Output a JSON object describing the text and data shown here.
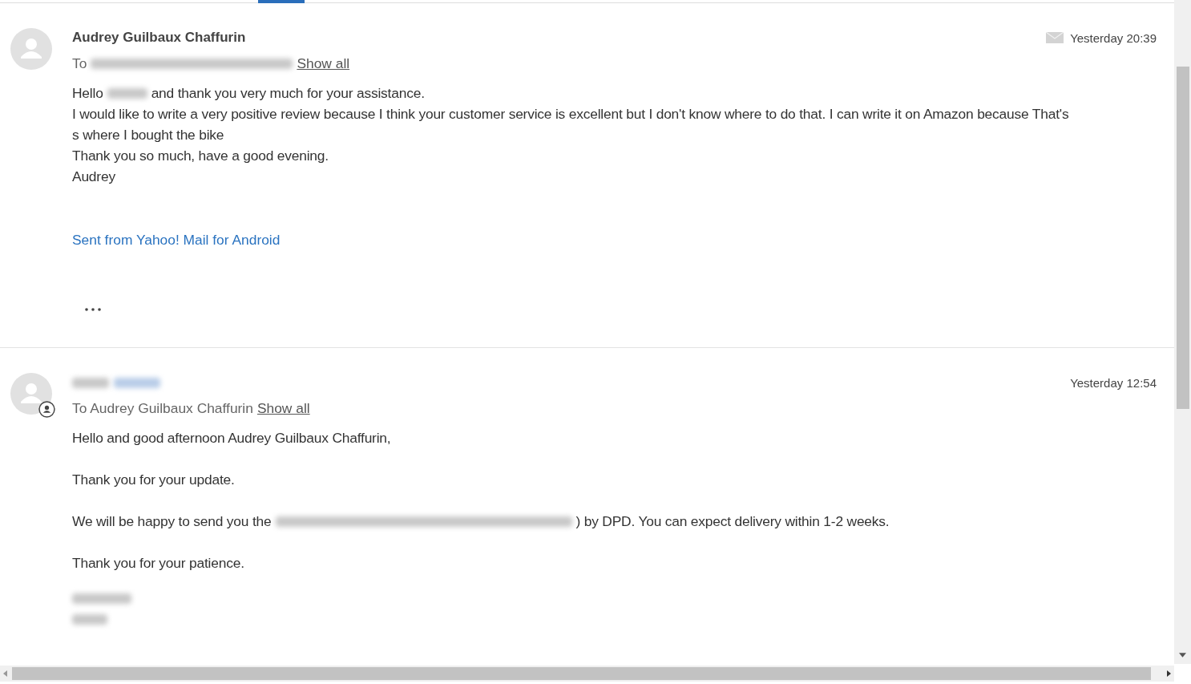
{
  "messages": [
    {
      "sender": [
        {
          "kind": "text",
          "text": "Audrey Guilbaux Chaffurin"
        }
      ],
      "time": "Yesterday 20:39",
      "envelope": true,
      "agent": false,
      "to": [
        {
          "kind": "text",
          "text": "To"
        },
        {
          "kind": "redacted"
        }
      ],
      "show_all": "Show all",
      "body": [
        {
          "kind": "text",
          "segments": [
            {
              "kind": "text",
              "text": "Hello"
            },
            {
              "kind": "redacted"
            },
            {
              "kind": "text",
              "text": "and thank you very much for your assistance."
            }
          ]
        },
        {
          "kind": "text",
          "segments": [
            {
              "kind": "text",
              "text": "I would like to write a very positive review because I think your customer service is excellent but I don't know where to do that. I can write it on Amazon because That's"
            }
          ]
        },
        {
          "kind": "text",
          "segments": [
            {
              "kind": "text",
              "text": "s where I bought the bike"
            }
          ]
        },
        {
          "kind": "text",
          "segments": [
            {
              "kind": "text",
              "text": "Thank you so much, have a good evening."
            }
          ]
        },
        {
          "kind": "text",
          "segments": [
            {
              "kind": "text",
              "text": "Audrey"
            }
          ]
        }
      ],
      "signature_link": "Sent from Yahoo! Mail for Android",
      "more": true
    },
    {
      "sender": [
        {
          "kind": "redacted"
        },
        {
          "kind": "redacted-link"
        }
      ],
      "time": "Yesterday 12:54",
      "envelope": false,
      "agent": true,
      "to": [
        {
          "kind": "text",
          "text": "To Audrey Guilbaux Chaffurin"
        }
      ],
      "show_all": "Show all",
      "body": [
        {
          "kind": "text",
          "segments": [
            {
              "kind": "text",
              "text": "Hello and good afternoon Audrey Guilbaux Chaffurin,"
            }
          ]
        },
        {
          "kind": "blank"
        },
        {
          "kind": "text",
          "segments": [
            {
              "kind": "text",
              "text": "Thank you for your update."
            }
          ]
        },
        {
          "kind": "blank"
        },
        {
          "kind": "text",
          "segments": [
            {
              "kind": "text",
              "text": "We will be happy to send you the"
            },
            {
              "kind": "redacted"
            },
            {
              "kind": "text",
              "text": ") by DPD. You can expect delivery within 1-2 weeks."
            }
          ]
        },
        {
          "kind": "blank"
        },
        {
          "kind": "text",
          "segments": [
            {
              "kind": "text",
              "text": "Thank you for your patience."
            }
          ]
        },
        {
          "kind": "blank-small"
        },
        {
          "kind": "text",
          "segments": [
            {
              "kind": "redacted"
            }
          ]
        },
        {
          "kind": "text",
          "segments": [
            {
              "kind": "redacted"
            }
          ]
        }
      ],
      "more": false
    }
  ]
}
